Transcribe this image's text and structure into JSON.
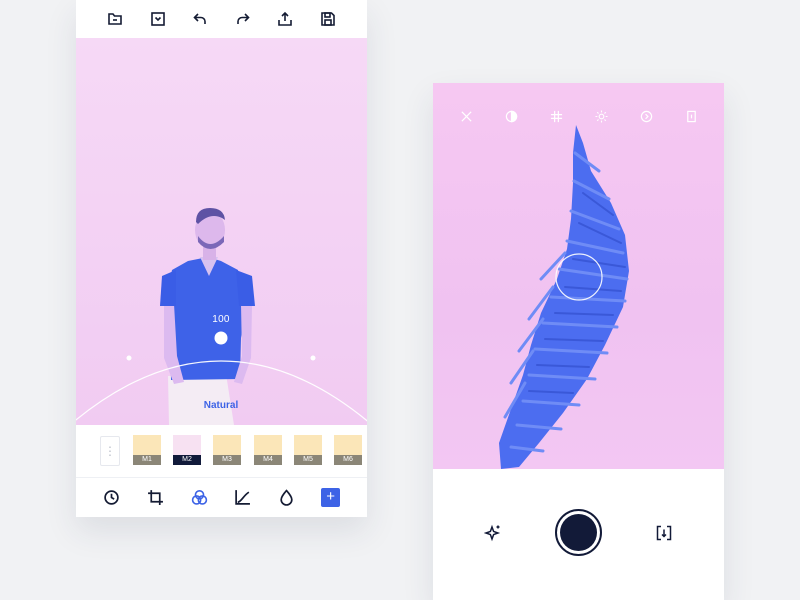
{
  "editor": {
    "top_toolbar": [
      "folder-icon",
      "save-to-device-icon",
      "undo-icon",
      "redo-icon",
      "share-icon",
      "save-icon"
    ],
    "slider": {
      "value_label": "100",
      "value": 100,
      "filter_name": "Natural"
    },
    "presets": [
      {
        "label": "M1",
        "selected": false
      },
      {
        "label": "M2",
        "selected": true
      },
      {
        "label": "M3",
        "selected": false
      },
      {
        "label": "M4",
        "selected": false
      },
      {
        "label": "M5",
        "selected": false
      },
      {
        "label": "M6",
        "selected": false
      }
    ],
    "bottom_toolbar": [
      "history-icon",
      "crop-icon",
      "filters-icon",
      "curves-icon",
      "color-drop-icon",
      "add-icon"
    ],
    "add_label": "+",
    "accent": "#3d63e6"
  },
  "camera": {
    "top_toolbar": [
      "close-icon",
      "contrast-icon",
      "grid-icon",
      "exposure-icon",
      "timer-icon",
      "aspect-icon"
    ],
    "controls": [
      "magic-icon",
      "shutter-button",
      "switch-camera-icon"
    ],
    "shutter_color": "#121a38"
  }
}
